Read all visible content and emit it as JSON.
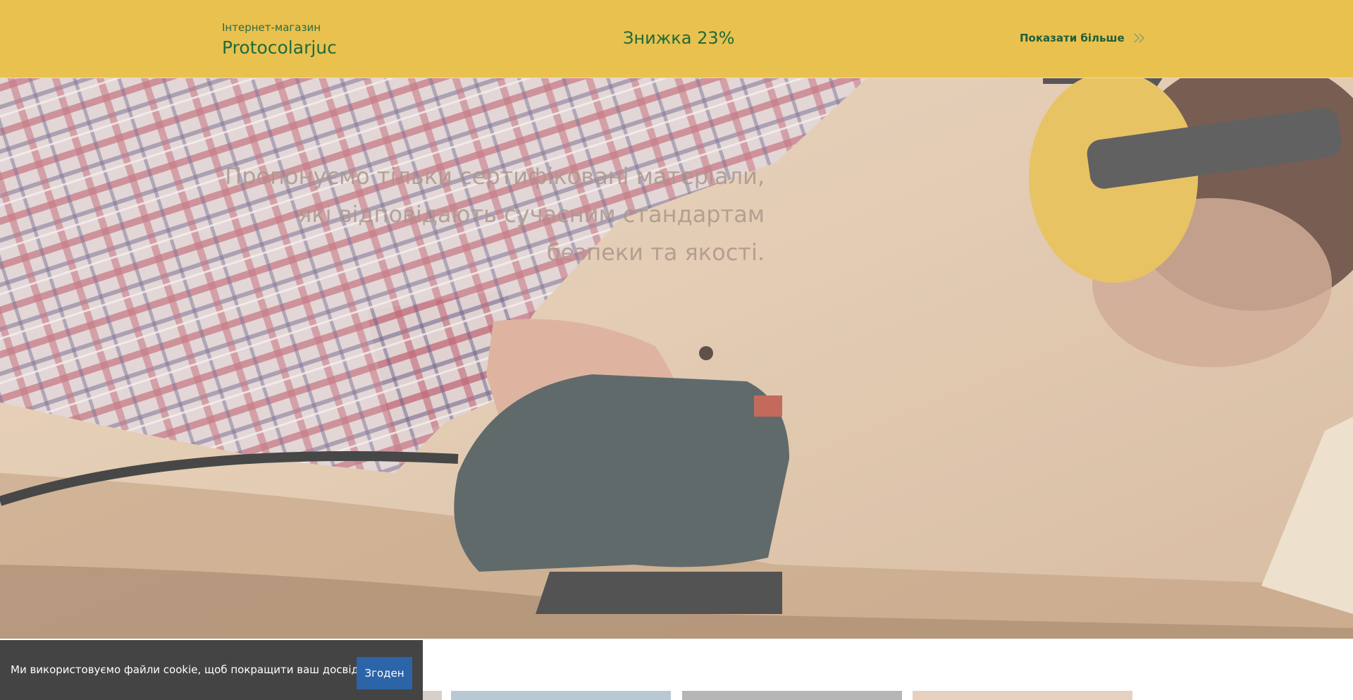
{
  "header": {
    "subtitle": "Інтернет-магазин",
    "title": "Protocolarjuc",
    "promo": "Знижка 23%",
    "more_label": "Показати більше",
    "more_icon": "double-chevron-right-icon",
    "bg_color": "#e9c14f",
    "text_color": "#1f6b3b"
  },
  "hero": {
    "text": "Пропонуємо тільки сертифіковані матеріали, які відповідають сучасним стандартам безпеки та якості.",
    "image": "woodworker-jigsaw-photo"
  },
  "cookie": {
    "message": "Ми використовуємо файли cookie, щоб покращити ваш досвід.",
    "button_label": "Згоден",
    "button_color": "#2c64a8"
  }
}
